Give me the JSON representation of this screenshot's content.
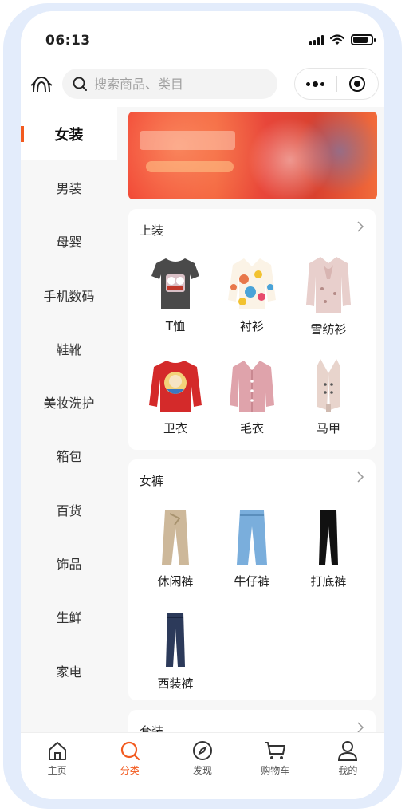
{
  "status_bar": {
    "time": "06:13",
    "battery_level": 0.8
  },
  "header": {
    "search": {
      "placeholder": "搜索商品、类目"
    }
  },
  "sidebar": {
    "items": [
      {
        "label": "女装",
        "active": true
      },
      {
        "label": "男装"
      },
      {
        "label": "母婴"
      },
      {
        "label": "手机数码"
      },
      {
        "label": "鞋靴"
      },
      {
        "label": "美妆洗护"
      },
      {
        "label": "箱包"
      },
      {
        "label": "百货"
      },
      {
        "label": "饰品"
      },
      {
        "label": "生鲜"
      },
      {
        "label": "家电"
      }
    ]
  },
  "sections": [
    {
      "title": "上装",
      "items": [
        {
          "label": "T恤",
          "icon": "tshirt-icon"
        },
        {
          "label": "衬衫",
          "icon": "shirt-icon"
        },
        {
          "label": "雪纺衫",
          "icon": "chiffon-blouse-icon"
        },
        {
          "label": "卫衣",
          "icon": "hoodie-icon"
        },
        {
          "label": "毛衣",
          "icon": "sweater-icon"
        },
        {
          "label": "马甲",
          "icon": "vest-icon"
        }
      ]
    },
    {
      "title": "女裤",
      "items": [
        {
          "label": "休闲裤",
          "icon": "casual-pants-icon"
        },
        {
          "label": "牛仔裤",
          "icon": "jeans-icon"
        },
        {
          "label": "打底裤",
          "icon": "leggings-icon"
        },
        {
          "label": "西装裤",
          "icon": "suit-pants-icon"
        }
      ]
    },
    {
      "title": "套装",
      "items": []
    }
  ],
  "tabbar": {
    "items": [
      {
        "label": "主页",
        "icon": "home-icon"
      },
      {
        "label": "分类",
        "icon": "category-search-icon",
        "active": true
      },
      {
        "label": "发现",
        "icon": "compass-icon"
      },
      {
        "label": "购物车",
        "icon": "cart-icon"
      },
      {
        "label": "我的",
        "icon": "user-icon"
      }
    ]
  },
  "colors": {
    "accent": "#f25a1f",
    "sidebar_bg": "#f7f7f7",
    "frame": "#e3ecfb"
  }
}
